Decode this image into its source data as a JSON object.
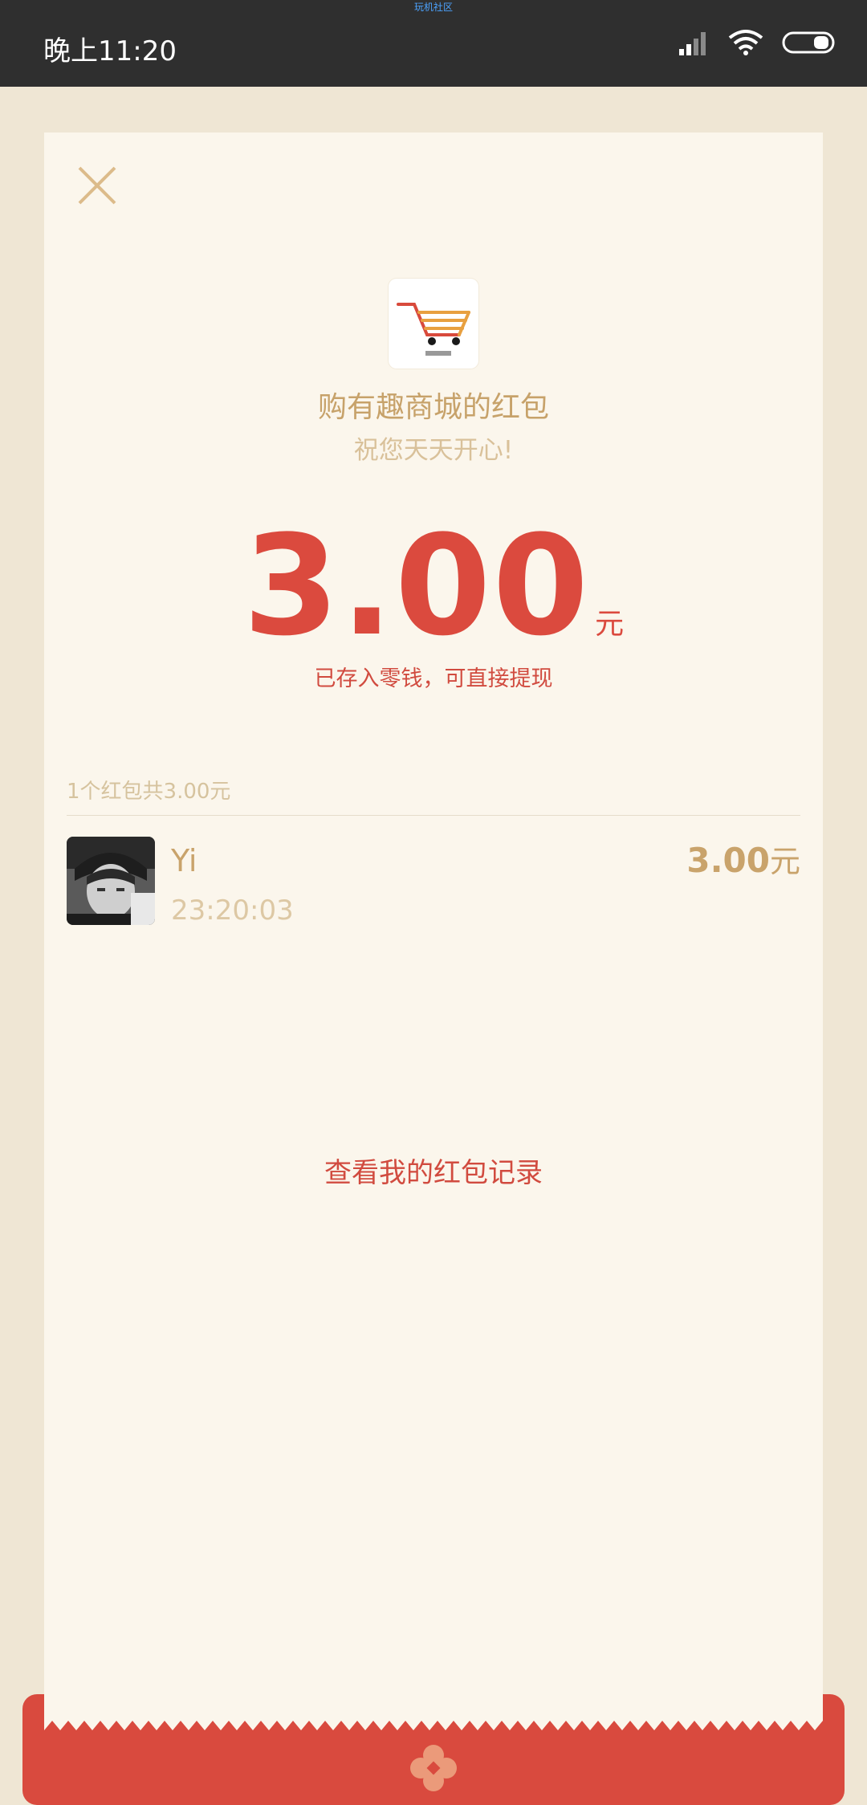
{
  "status_bar": {
    "time": "晚上11:20",
    "top_text": "玩机社区",
    "icons": [
      "signal-icon",
      "wifi-icon",
      "battery-icon"
    ]
  },
  "red_packet": {
    "sender_title": "购有趣商城的红包",
    "greeting": "祝您天天开心!",
    "amount": "3.00",
    "unit": "元",
    "stored_note": "已存入零钱，可直接提现",
    "summary": "1个红包共3.00元",
    "recipient": {
      "name": "Yi",
      "time": "23:20:03",
      "amount": "3.00",
      "unit": "元"
    },
    "history_link": "查看我的红包记录"
  },
  "colors": {
    "page_bg": "#efe6d4",
    "card_bg": "#fbf6ec",
    "accent_red": "#db4a3e",
    "gold": "#c9a36b",
    "status_bar_bg": "#2f2f2f"
  }
}
